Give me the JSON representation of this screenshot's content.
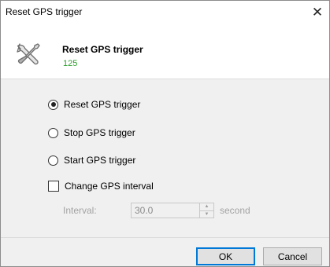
{
  "window": {
    "title": "Reset GPS trigger",
    "close_symbol": "✕"
  },
  "header": {
    "icon": "tools-icon",
    "title": "Reset GPS trigger",
    "subtitle": "125",
    "subtitle_color": "#2a9e2a"
  },
  "options": [
    {
      "label": "Reset GPS trigger",
      "selected": true
    },
    {
      "label": "Stop GPS trigger",
      "selected": false
    },
    {
      "label": "Start GPS trigger",
      "selected": false
    }
  ],
  "change_interval": {
    "label": "Change GPS interval",
    "checked": false
  },
  "interval": {
    "label": "Interval:",
    "value": "30.0",
    "unit": "second",
    "enabled": false
  },
  "buttons": {
    "ok": "OK",
    "cancel": "Cancel"
  },
  "colors": {
    "accent": "#0078d7",
    "dialog_bg": "#f0f0f0"
  }
}
